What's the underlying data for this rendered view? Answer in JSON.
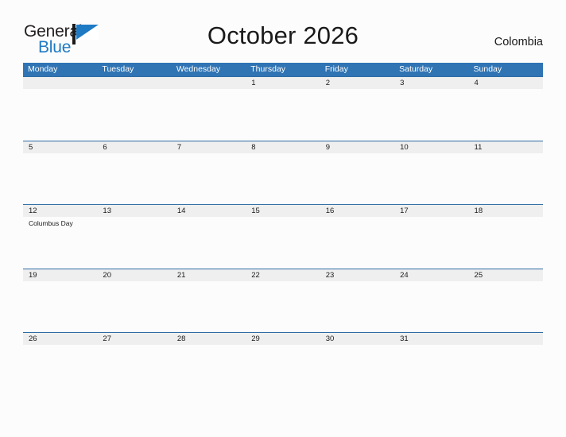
{
  "brand": {
    "name_part1": "General",
    "name_part2": "Blue",
    "flag_icon": "flag-triangle-icon",
    "colors": {
      "text_dark": "#231f20",
      "blue": "#1f7ac4"
    }
  },
  "header": {
    "title": "October 2026",
    "country": "Colombia"
  },
  "theme": {
    "header_blue": "#3074b4",
    "row_border_blue": "#2e6da4",
    "date_strip_gray": "#efefef",
    "page_background": "#fcfcfc",
    "text_color": "#1a1a1a",
    "weekday_text": "#ffffff"
  },
  "calendar": {
    "weekdays": [
      "Monday",
      "Tuesday",
      "Wednesday",
      "Thursday",
      "Friday",
      "Saturday",
      "Sunday"
    ],
    "weeks": [
      {
        "days": [
          {
            "number": "",
            "event": ""
          },
          {
            "number": "",
            "event": ""
          },
          {
            "number": "",
            "event": ""
          },
          {
            "number": "1",
            "event": ""
          },
          {
            "number": "2",
            "event": ""
          },
          {
            "number": "3",
            "event": ""
          },
          {
            "number": "4",
            "event": ""
          }
        ]
      },
      {
        "days": [
          {
            "number": "5",
            "event": ""
          },
          {
            "number": "6",
            "event": ""
          },
          {
            "number": "7",
            "event": ""
          },
          {
            "number": "8",
            "event": ""
          },
          {
            "number": "9",
            "event": ""
          },
          {
            "number": "10",
            "event": ""
          },
          {
            "number": "11",
            "event": ""
          }
        ]
      },
      {
        "days": [
          {
            "number": "12",
            "event": "Columbus Day"
          },
          {
            "number": "13",
            "event": ""
          },
          {
            "number": "14",
            "event": ""
          },
          {
            "number": "15",
            "event": ""
          },
          {
            "number": "16",
            "event": ""
          },
          {
            "number": "17",
            "event": ""
          },
          {
            "number": "18",
            "event": ""
          }
        ]
      },
      {
        "days": [
          {
            "number": "19",
            "event": ""
          },
          {
            "number": "20",
            "event": ""
          },
          {
            "number": "21",
            "event": ""
          },
          {
            "number": "22",
            "event": ""
          },
          {
            "number": "23",
            "event": ""
          },
          {
            "number": "24",
            "event": ""
          },
          {
            "number": "25",
            "event": ""
          }
        ]
      },
      {
        "days": [
          {
            "number": "26",
            "event": ""
          },
          {
            "number": "27",
            "event": ""
          },
          {
            "number": "28",
            "event": ""
          },
          {
            "number": "29",
            "event": ""
          },
          {
            "number": "30",
            "event": ""
          },
          {
            "number": "31",
            "event": ""
          },
          {
            "number": "",
            "event": ""
          }
        ]
      }
    ]
  }
}
